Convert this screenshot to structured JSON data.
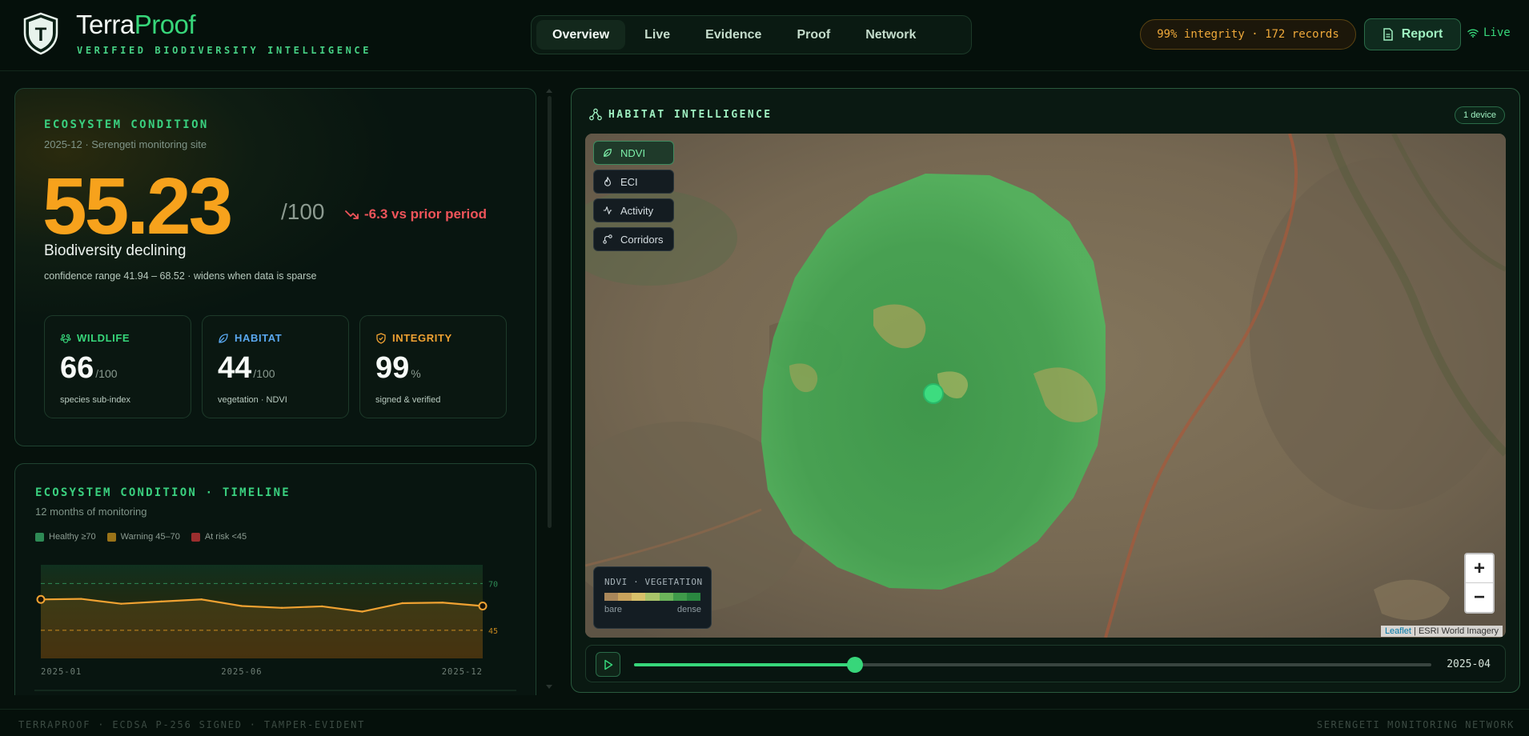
{
  "header": {
    "brand_part1": "Terra",
    "brand_part2": "Proof",
    "tagline": "VERIFIED BIODIVERSITY INTELLIGENCE",
    "logo_letter": "T",
    "tabs": [
      {
        "label": "Overview",
        "active": true
      },
      {
        "label": "Live",
        "active": false
      },
      {
        "label": "Evidence",
        "active": false
      },
      {
        "label": "Proof",
        "active": false
      },
      {
        "label": "Network",
        "active": false
      }
    ],
    "integrity_pill": "99% integrity · 172 records",
    "report_button": "Report",
    "live_label": "Live"
  },
  "ecosystem": {
    "title": "ECOSYSTEM CONDITION",
    "subtitle": "2025-12 · Serengeti monitoring site",
    "score": "55.23",
    "score_max": "/100",
    "delta": "-6.3 vs prior period",
    "status": "Biodiversity declining",
    "confidence": "confidence range 41.94 – 68.52 · widens when data is sparse",
    "subindices": [
      {
        "label": "WILDLIFE",
        "value": "66",
        "unit": "/100",
        "caption": "species sub-index",
        "color": "#37d67a",
        "icon": "paw-icon"
      },
      {
        "label": "HABITAT",
        "value": "44",
        "unit": "/100",
        "caption": "vegetation · NDVI",
        "color": "#5aa8f0",
        "icon": "leaf-icon"
      },
      {
        "label": "INTEGRITY",
        "value": "99",
        "unit": "%",
        "caption": "signed & verified",
        "color": "#f0a232",
        "icon": "shield-check-icon"
      }
    ]
  },
  "timeline": {
    "title": "ECOSYSTEM CONDITION · TIMELINE",
    "subtitle": "12 months of monitoring",
    "legend": [
      {
        "label": "Healthy ≥70",
        "color": "#2e8a55"
      },
      {
        "label": "Warning 45–70",
        "color": "#9a7318"
      },
      {
        "label": "At risk <45",
        "color": "#9b2e2e"
      }
    ]
  },
  "chart_data": {
    "type": "line",
    "x": [
      "2025-01",
      "2025-02",
      "2025-03",
      "2025-04",
      "2025-05",
      "2025-06",
      "2025-07",
      "2025-08",
      "2025-09",
      "2025-10",
      "2025-11",
      "2025-12"
    ],
    "x_tick_labels": [
      "2025-01",
      "2025-06",
      "2025-12"
    ],
    "series": [
      {
        "values": [
          61.5,
          61.8,
          59.2,
          60.4,
          61.5,
          58.0,
          57.0,
          57.8,
          55.0,
          59.5,
          59.8,
          58.0
        ]
      }
    ],
    "ylim": [
      30,
      80
    ],
    "thresholds": [
      {
        "label": "70",
        "value": 70,
        "color": "#2e8a55"
      },
      {
        "label": "45",
        "value": 45,
        "color": "#c4871e"
      }
    ]
  },
  "habitat": {
    "title": "HABITAT INTELLIGENCE",
    "device_badge": "1 device",
    "layers": [
      {
        "label": "NDVI",
        "active": true,
        "icon": "leaf-icon"
      },
      {
        "label": "ECI",
        "active": false,
        "icon": "flame-icon"
      },
      {
        "label": "Activity",
        "active": false,
        "icon": "activity-icon"
      },
      {
        "label": "Corridors",
        "active": false,
        "icon": "route-icon"
      }
    ],
    "ndvi_legend": {
      "title": "NDVI · VEGETATION",
      "low": "bare",
      "high": "dense",
      "colors": [
        "#a9875a",
        "#c9a35c",
        "#d8c06a",
        "#a9c46a",
        "#6cb55a",
        "#3f9a4a",
        "#2a8740"
      ]
    },
    "zoom_in": "+",
    "zoom_out": "−",
    "attribution_leaflet": "Leaflet",
    "attribution_rest": " | ESRI World Imagery",
    "timeline_date": "2025-04",
    "timeline_progress": 0.277
  },
  "footer": {
    "left": "TERRAPROOF · ECDSA P-256 SIGNED · TAMPER-EVIDENT",
    "right": "SERENGETI MONITORING NETWORK"
  }
}
